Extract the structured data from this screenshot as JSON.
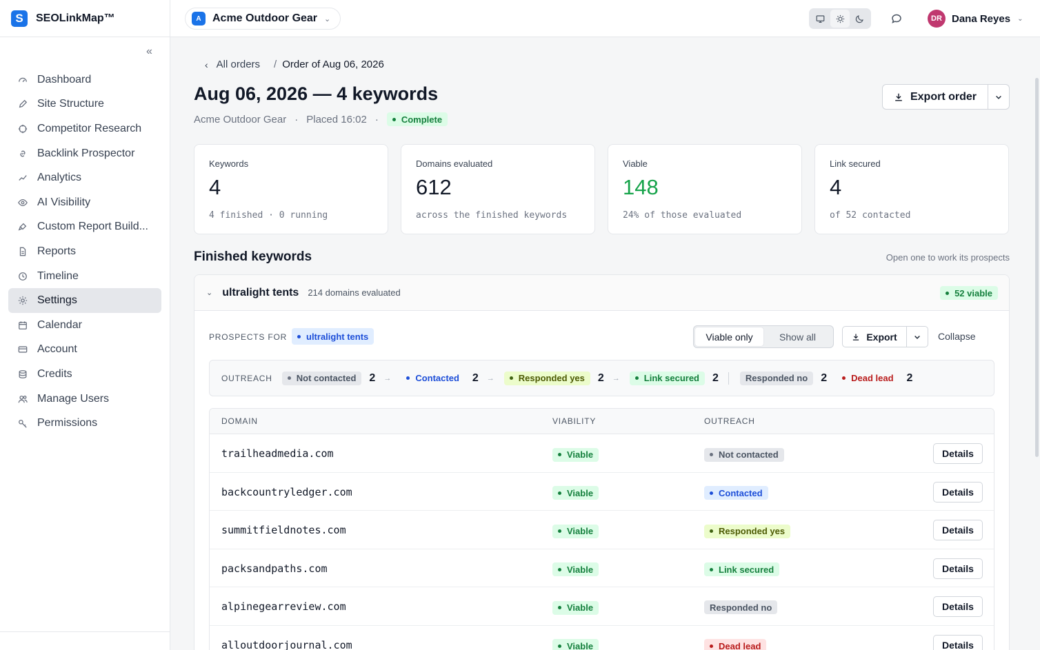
{
  "brand": {
    "logo_letter": "S",
    "name": "SEOLinkMap™",
    "color": "#1a73e8"
  },
  "sidebar": {
    "collapse_icon": "double-chevron-left-icon",
    "items": [
      {
        "label": "Dashboard",
        "icon": "gauge-icon"
      },
      {
        "label": "Site Structure",
        "icon": "pen-icon"
      },
      {
        "label": "Competitor Research",
        "icon": "target-icon"
      },
      {
        "label": "Backlink Prospector",
        "icon": "link-icon"
      },
      {
        "label": "Analytics",
        "icon": "trend-icon"
      },
      {
        "label": "AI Visibility",
        "icon": "eye-icon"
      },
      {
        "label": "Custom Report Build...",
        "icon": "brush-icon"
      },
      {
        "label": "Reports",
        "icon": "file-icon"
      },
      {
        "label": "Timeline",
        "icon": "clock-icon"
      },
      {
        "label": "Settings",
        "icon": "gear-icon",
        "active": true
      },
      {
        "label": "Calendar",
        "icon": "calendar-icon"
      },
      {
        "label": "Account",
        "icon": "card-icon"
      },
      {
        "label": "Credits",
        "icon": "database-icon"
      },
      {
        "label": "Manage Users",
        "icon": "users-icon"
      },
      {
        "label": "Permissions",
        "icon": "key-icon"
      }
    ]
  },
  "topbar": {
    "workspace": {
      "initial": "A",
      "name": "Acme Outdoor Gear"
    },
    "user": {
      "initials": "DR",
      "name": "Dana Reyes",
      "avatar_color": "#c0386f"
    }
  },
  "breadcrumb": {
    "parent": "All orders",
    "separator": "/",
    "current": "Order of Aug 06, 2026"
  },
  "page": {
    "title": "Aug 06, 2026 — 4 keywords",
    "client": "Acme Outdoor Gear",
    "placed": "Placed 16:02",
    "meta_sep": "·",
    "status": "Complete",
    "export_label": "Export order"
  },
  "stats": [
    {
      "label": "Keywords",
      "value": "4",
      "sub": "4 finished · 0 running"
    },
    {
      "label": "Domains evaluated",
      "value": "612",
      "sub": "across the finished keywords"
    },
    {
      "label": "Viable",
      "value": "148",
      "sub": "24% of those evaluated",
      "accent": "#16a34a"
    },
    {
      "label": "Link secured",
      "value": "4",
      "sub": "of 52 contacted"
    }
  ],
  "section": {
    "title": "Finished keywords",
    "hint": "Open one to work its prospects"
  },
  "keyword": {
    "name": "ultralight tents",
    "evaluated": "214 domains evaluated",
    "viable_badge": "52 viable",
    "prospects_label": "PROSPECTS FOR",
    "prospects_kw": "ultralight tents",
    "filter_options": [
      "Viable only",
      "Show all"
    ],
    "export_label": "Export",
    "collapse_label": "Collapse"
  },
  "outreach_summary": {
    "label": "OUTREACH",
    "arrow": "→",
    "stages": [
      {
        "label": "Not contacted",
        "count": "2"
      },
      {
        "label": "Contacted",
        "count": "2"
      },
      {
        "label": "Responded yes",
        "count": "2"
      },
      {
        "label": "Link secured",
        "count": "2"
      },
      {
        "label": "Responded no",
        "count": "2"
      },
      {
        "label": "Dead lead",
        "count": "2"
      }
    ]
  },
  "table": {
    "columns": [
      "DOMAIN",
      "VIABILITY",
      "OUTREACH"
    ],
    "details_label": "Details",
    "rows": [
      {
        "domain": "trailheadmedia.com",
        "viability": "Viable",
        "outreach": "Not contacted"
      },
      {
        "domain": "backcountryledger.com",
        "viability": "Viable",
        "outreach": "Contacted"
      },
      {
        "domain": "summitfieldnotes.com",
        "viability": "Viable",
        "outreach": "Responded yes"
      },
      {
        "domain": "packsandpaths.com",
        "viability": "Viable",
        "outreach": "Link secured"
      },
      {
        "domain": "alpinegearreview.com",
        "viability": "Viable",
        "outreach": "Responded no"
      },
      {
        "domain": "alloutdoorjournal.com",
        "viability": "Viable",
        "outreach": "Dead lead"
      }
    ]
  }
}
